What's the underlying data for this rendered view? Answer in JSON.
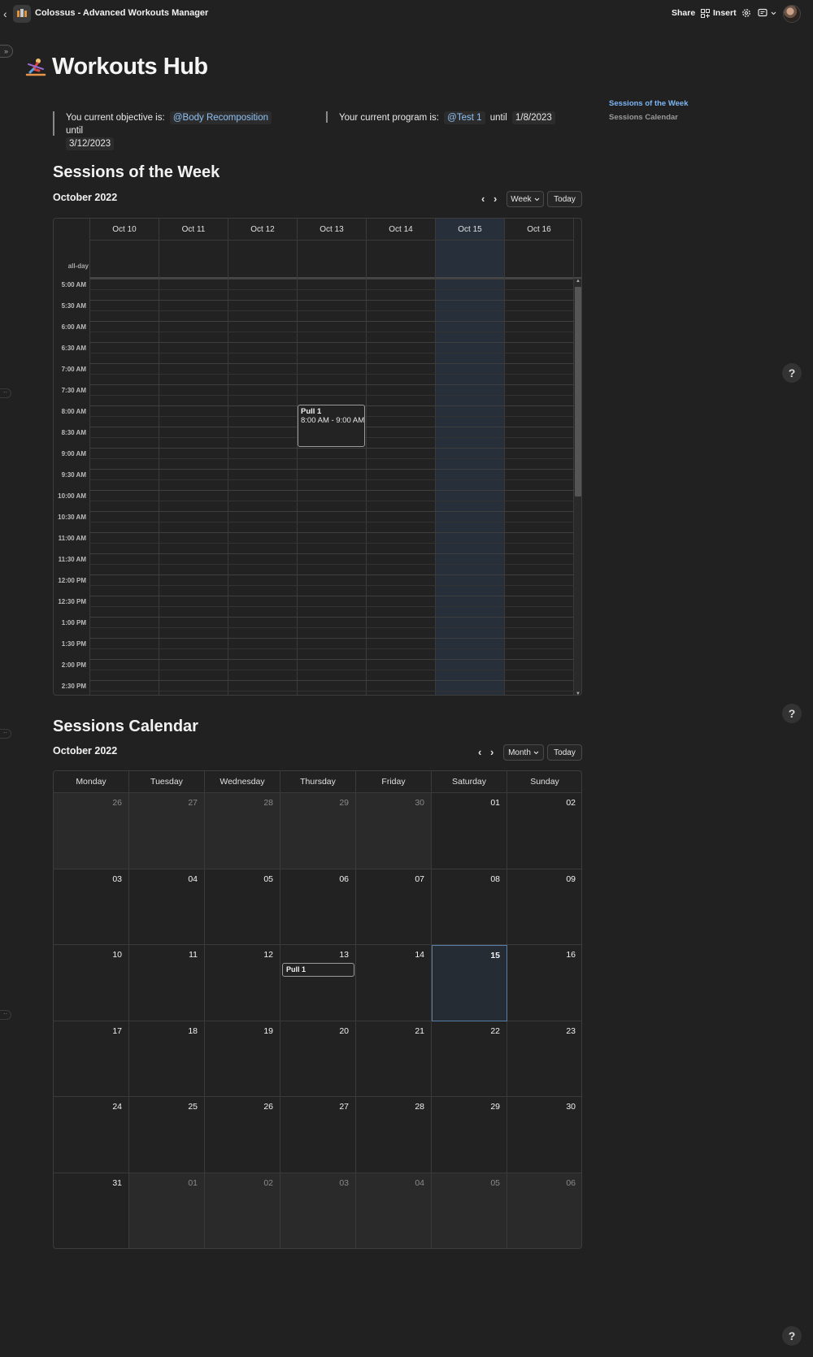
{
  "header": {
    "title": "Colossus - Advanced Workouts Manager",
    "share": "Share",
    "insert": "Insert"
  },
  "page": {
    "title": "Workouts Hub"
  },
  "toc": {
    "items": [
      "Sessions of the Week",
      "Sessions Calendar"
    ]
  },
  "objective": {
    "prefix": "You current objective is:",
    "mention": "@Body Recomposition",
    "until": "until",
    "date": "3/12/2023"
  },
  "program": {
    "prefix": "Your current program is:",
    "mention": "@Test 1",
    "until": "until",
    "date": "1/8/2023"
  },
  "week_section": {
    "heading": "Sessions of the Week",
    "month": "October 2022",
    "view": "Week",
    "today": "Today",
    "allday": "all-day",
    "days": [
      "Oct 10",
      "Oct 11",
      "Oct 12",
      "Oct 13",
      "Oct 14",
      "Oct 15",
      "Oct 16"
    ],
    "today_index": 5,
    "times": [
      "5:00 AM",
      "5:30 AM",
      "6:00 AM",
      "6:30 AM",
      "7:00 AM",
      "7:30 AM",
      "8:00 AM",
      "8:30 AM",
      "9:00 AM",
      "9:30 AM",
      "10:00 AM",
      "10:30 AM",
      "11:00 AM",
      "11:30 AM",
      "12:00 PM",
      "12:30 PM",
      "1:00 PM",
      "1:30 PM",
      "2:00 PM",
      "2:30 PM"
    ],
    "event": {
      "title": "Pull 1",
      "time": "8:00 AM - 9:00 AM",
      "day": "Oct 13"
    }
  },
  "calendar_section": {
    "heading": "Sessions Calendar",
    "month": "October 2022",
    "view": "Month",
    "today": "Today",
    "weekdays": [
      "Monday",
      "Tuesday",
      "Wednesday",
      "Thursday",
      "Friday",
      "Saturday",
      "Sunday"
    ],
    "weeks": [
      [
        "26",
        "27",
        "28",
        "29",
        "30",
        "01",
        "02"
      ],
      [
        "03",
        "04",
        "05",
        "06",
        "07",
        "08",
        "09"
      ],
      [
        "10",
        "11",
        "12",
        "13",
        "14",
        "15",
        "16"
      ],
      [
        "17",
        "18",
        "19",
        "20",
        "21",
        "22",
        "23"
      ],
      [
        "24",
        "25",
        "26",
        "27",
        "28",
        "29",
        "30"
      ],
      [
        "31",
        "01",
        "02",
        "03",
        "04",
        "05",
        "06"
      ]
    ],
    "today_date": "15",
    "event": {
      "title": "Pull 1",
      "date": "13"
    }
  },
  "help": "?",
  "colors": {
    "background": "#212121",
    "mention": "#8ec2f7",
    "toc_active": "#7db6f5",
    "today_highlight": "#27303a"
  }
}
